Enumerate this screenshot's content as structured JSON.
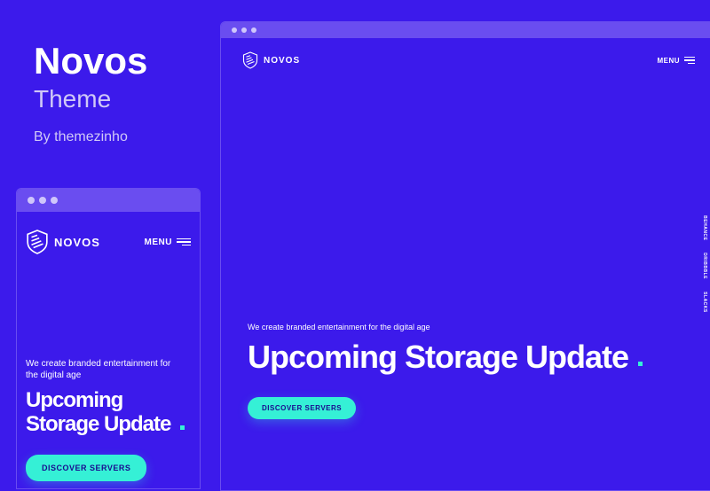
{
  "info": {
    "name": "Novos",
    "subtitle": "Theme",
    "author": "By themezinho"
  },
  "preview": {
    "logo_text": "NOVOS",
    "menu_label": "MENU",
    "tagline": "We create branded entertainment for the digital age",
    "headline": "Upcoming Storage Update",
    "cta": "DISCOVER SERVERS",
    "social": {
      "behance": "BEHANCE",
      "dribbble": "DRIBBBLE",
      "slacks": "SLACKS"
    }
  }
}
